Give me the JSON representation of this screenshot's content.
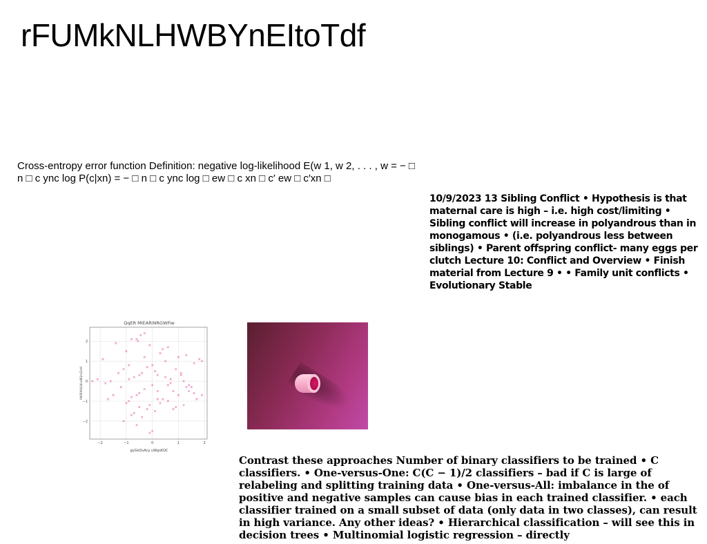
{
  "title": "rFUMkNLHWBYnEItoTdf",
  "crossentropy_text": "Cross-entropy error function Definition: negative log-likelihood E(w 1, w 2, . . . , w = − □ n □ c ync log P(c|xn) = − □ n □ c ync log □ ew □ c xn □ c′ ew □ c′xn □",
  "sibling_text": "10/9/2023 13 Sibling Conflict • Hypothesis is that maternal care is high – i.e. high cost/limiting • Sibling conflict will increase in polyandrous than in monogamous • (i.e. polyandrous less between siblings) • Parent offspring conflict- many eggs per clutch Lecture 10: Conflict and Overview • Finish material from Lecture 9 • • Family unit conflicts • Evolutionary Stable",
  "contrast_text": "Contrast these approaches Number of binary classifiers to be trained • C classifiers. • One-versus-One: C(C − 1)/2 classifiers – bad if C is large of relabeling and splitting training data • One-versus-All: imbalance in the of positive and negative samples can cause bias in each trained classifier. • each classifier trained on a small subset of data (only data in two classes), can result in high variance. Any other ideas? • Hierarchical classification – will see this in decision trees • Multinomial logistic regression – directly",
  "chart_data": {
    "type": "scatter",
    "title": "QqER MIEARiNRGWFiw",
    "xlabel": "gyGkQvAcy uWgsKQC",
    "ylabel": "fkKIRXIULUILrIBQrnZxHI",
    "xlim": [
      -2.4,
      2.1
    ],
    "ylim": [
      -2.9,
      2.7
    ],
    "xticks": [
      -2,
      -1,
      0,
      1,
      2
    ],
    "yticks": [
      -2,
      -1,
      0,
      1,
      2
    ],
    "grid": true,
    "marker": "x",
    "color": "#e46aa8",
    "x": [
      -0.45,
      -0.6,
      -0.3,
      -0.8,
      -0.55,
      -1.4,
      -1.0,
      -0.1,
      0.4,
      0.6,
      0.3,
      1.3,
      1.6,
      1.8,
      1.9,
      1.0,
      0.9,
      -0.9,
      -1.1,
      -1.3,
      -0.2,
      0.1,
      0.2,
      -0.4,
      -0.5,
      -0.7,
      0.5,
      0.7,
      1.1,
      1.2,
      1.4,
      1.5,
      -1.6,
      -1.8,
      -2.1,
      -2.3,
      -1.2,
      0.0,
      -0.3,
      0.2,
      0.8,
      1.0,
      1.3,
      -0.5,
      -0.6,
      -0.8,
      -0.9,
      0.4,
      0.6,
      -0.1,
      -1.0,
      0.9,
      1.2,
      1.7,
      1.9,
      -0.2,
      0.1,
      -0.7,
      0.3,
      -0.4,
      -1.5,
      -1.7,
      0.0,
      0.5,
      1.1,
      -0.3,
      -0.9,
      0.6,
      0.2,
      -1.1,
      -0.6,
      1.4,
      0.8,
      -0.1,
      0.7,
      -0.5,
      0.0,
      -0.8,
      1.6,
      -1.9
    ],
    "y": [
      2.3,
      2.1,
      2.4,
      2.1,
      2.0,
      1.9,
      1.5,
      1.8,
      1.6,
      1.7,
      1.4,
      1.3,
      0.9,
      1.1,
      1.0,
      1.2,
      0.6,
      0.8,
      0.6,
      0.4,
      0.7,
      0.5,
      0.3,
      0.4,
      0.3,
      0.2,
      0.2,
      0.1,
      0.3,
      0.0,
      -0.2,
      -0.3,
      0.0,
      -0.1,
      0.1,
      0.0,
      -0.3,
      -0.2,
      -0.4,
      -0.5,
      -0.5,
      -0.7,
      -0.3,
      -0.6,
      -0.7,
      -0.8,
      -1.0,
      -0.9,
      -1.0,
      -1.2,
      -1.1,
      -1.3,
      -1.2,
      -0.9,
      -0.7,
      -1.4,
      -1.5,
      -1.6,
      -1.1,
      -1.8,
      -0.7,
      -0.9,
      0.8,
      1.0,
      0.4,
      1.2,
      0.1,
      -0.2,
      -0.9,
      -2.0,
      -2.2,
      -0.5,
      -1.4,
      -2.6,
      -0.1,
      -1.3,
      -2.5,
      -1.7,
      -0.6,
      1.1
    ]
  }
}
